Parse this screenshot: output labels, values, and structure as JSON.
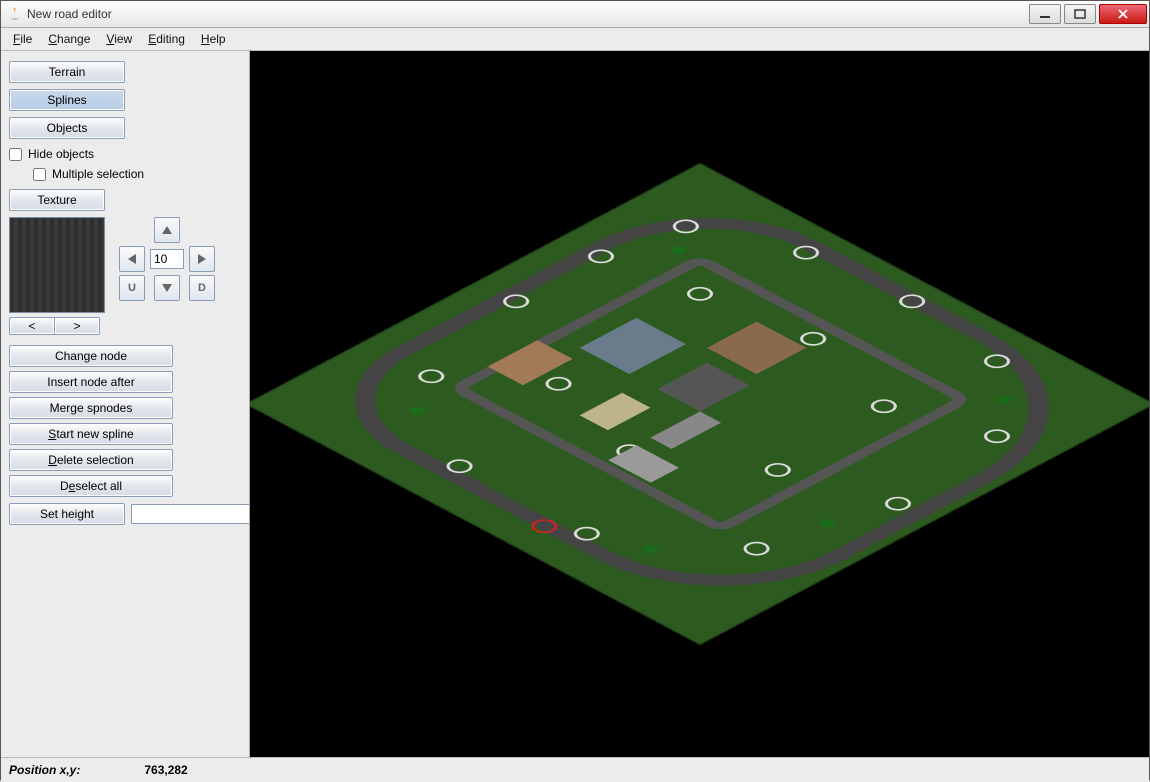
{
  "window": {
    "title": "New road editor"
  },
  "menu": {
    "file": "File",
    "change": "Change",
    "view": "View",
    "editing": "Editing",
    "help": "Help"
  },
  "sidebar": {
    "tabs": {
      "terrain": "Terrain",
      "splines": "Splines",
      "objects": "Objects"
    },
    "hide_objects": "Hide objects",
    "multiple_selection": "Multiple selection",
    "texture_btn": "Texture",
    "nav_value": "10",
    "nav_u": "U",
    "nav_d": "D",
    "prev": "<",
    "next": ">",
    "change_node": "Change node",
    "insert_node_after": "Insert node after",
    "merge_spnodes": "Merge spnodes",
    "start_new_spline": "Start new spline",
    "delete_selection": "Delete selection",
    "deselect_all": "Deselect all",
    "set_height": "Set height",
    "set_height_value": ""
  },
  "status": {
    "label": "Position x,y:",
    "coords": "763,282"
  }
}
